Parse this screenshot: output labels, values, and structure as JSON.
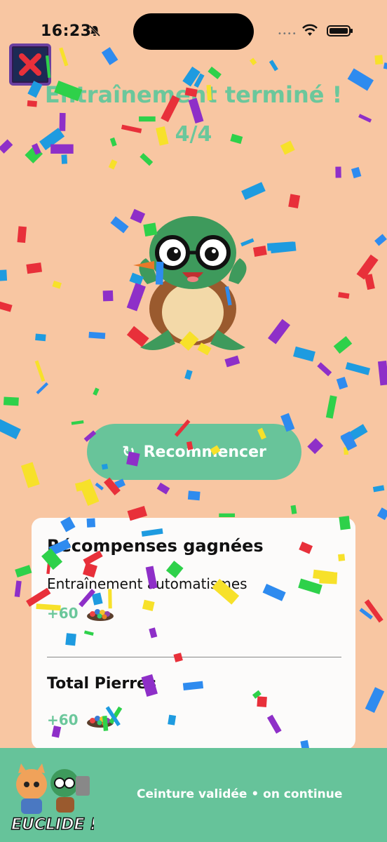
{
  "status_bar": {
    "time": "16:23",
    "dots": "••••"
  },
  "header": {
    "title": "Entraînement terminé !",
    "progress": "4/4"
  },
  "restart_button": {
    "label": "Recommencer",
    "icon": "↻"
  },
  "rewards_card": {
    "title": "Récompenses gagnées",
    "activity": "Entraînement automatismes",
    "activity_reward": "+60",
    "total_title": "Total Pierres",
    "total_value": "+60"
  },
  "footer": {
    "logo_text": "EUCLIDE !",
    "tagline": "Ceinture validée • on continue"
  },
  "colors": {
    "background": "#F8C6A2",
    "accent": "#6BC79B",
    "footer": "#66C39A"
  }
}
